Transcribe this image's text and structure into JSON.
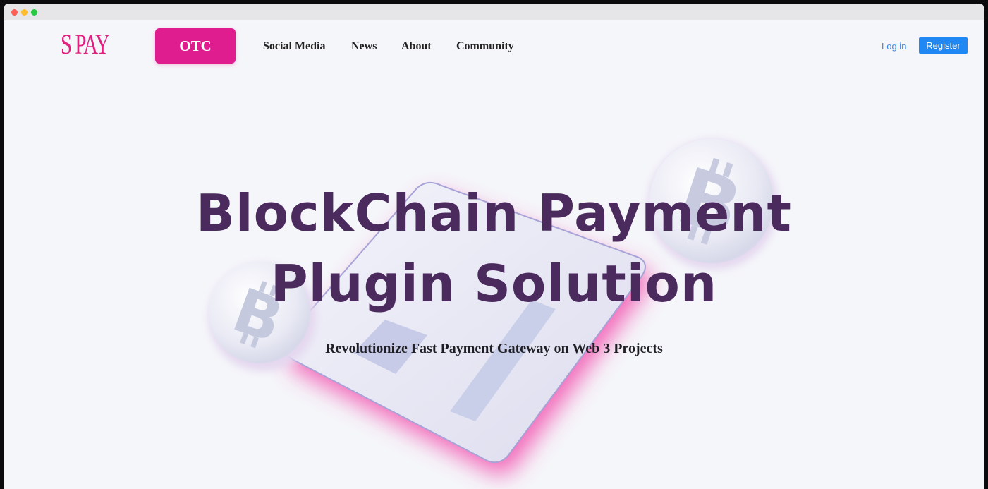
{
  "window": {
    "controls": [
      "close",
      "minimize",
      "maximize"
    ]
  },
  "nav": {
    "logo": "S PAY",
    "otc_label": "OTC",
    "links": [
      "Social Media",
      "News",
      "About",
      "Community"
    ],
    "login_label": "Log in",
    "register_label": "Register"
  },
  "hero": {
    "title_line1": "BlockChain Payment",
    "title_line2": "Plugin Solution",
    "subtitle": "Revolutionize Fast Payment Gateway on Web 3 Projects",
    "coin_icon": "bitcoin-icon",
    "card_icon": "credit-card-icon"
  },
  "colors": {
    "brand": "#e01d8e",
    "accent_blue": "#1f88f2",
    "title": "#4b2a5e",
    "background": "#f5f6fa"
  }
}
